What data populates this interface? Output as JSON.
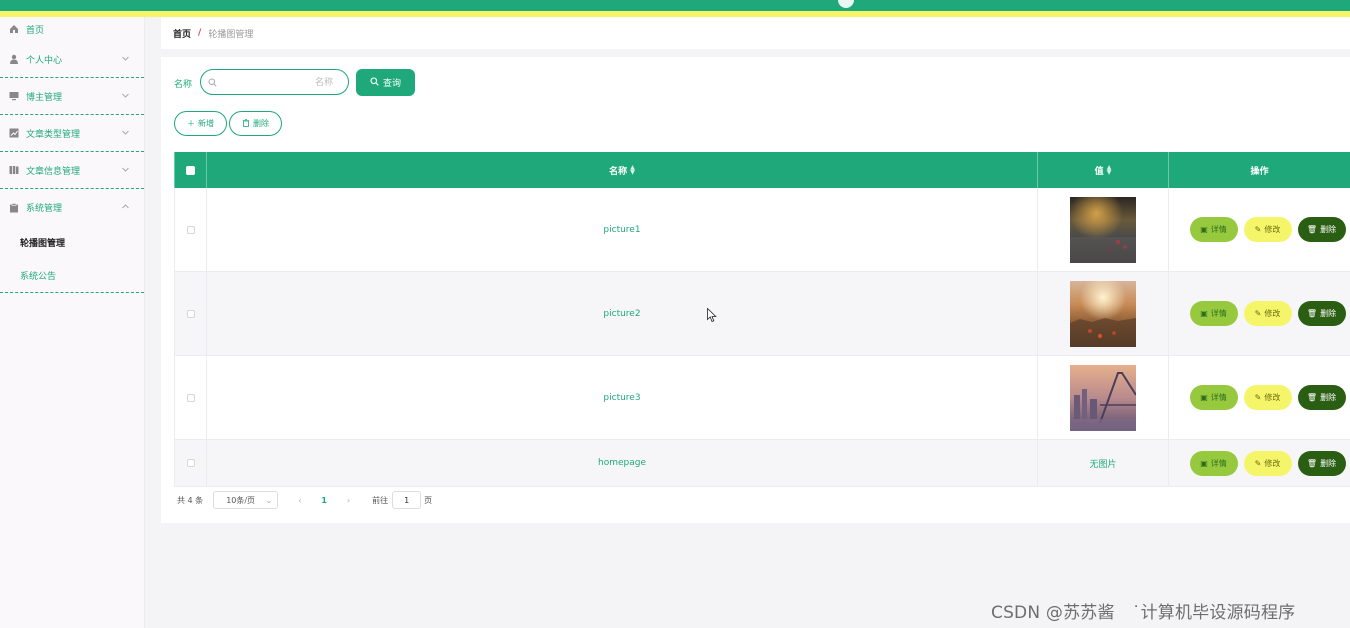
{
  "sidebar": {
    "items": [
      {
        "label": "首页",
        "icon": "home-icon"
      },
      {
        "label": "个人中心",
        "icon": "user-icon"
      },
      {
        "label": "博主管理",
        "icon": "monitor-icon"
      },
      {
        "label": "文章类型管理",
        "icon": "chart-icon"
      },
      {
        "label": "文章信息管理",
        "icon": "book-icon"
      },
      {
        "label": "系统管理",
        "icon": "clipboard-icon"
      }
    ],
    "sub_items": [
      {
        "label": "轮播图管理",
        "active": true
      },
      {
        "label": "系统公告",
        "active": false
      }
    ]
  },
  "breadcrumb": {
    "home": "首页",
    "separator": "/",
    "current": "轮播图管理"
  },
  "search": {
    "label": "名称",
    "placeholder": "名称",
    "button": "查询"
  },
  "actions": {
    "add": "新增",
    "delete": "删除"
  },
  "table": {
    "headers": {
      "name": "名称",
      "value": "值",
      "ops": "操作"
    },
    "rows": [
      {
        "name": "picture1",
        "value_type": "image",
        "value": ""
      },
      {
        "name": "picture2",
        "value_type": "image",
        "value": ""
      },
      {
        "name": "picture3",
        "value_type": "image",
        "value": ""
      },
      {
        "name": "homepage",
        "value_type": "text",
        "value": "无图片"
      }
    ],
    "row_actions": {
      "detail": "详情",
      "edit": "修改",
      "remove": "删除"
    }
  },
  "pagination": {
    "total": "共 4 条",
    "page_size": "10条/页",
    "current_page": "1",
    "goto_label": "前往",
    "goto_value": "1",
    "page_suffix": "页"
  },
  "watermark": "CSDN @苏苏酱　˙计算机毕设源码程序",
  "colors": {
    "primary": "#1fa97b",
    "accent_yellow": "#f7f46c",
    "detail_btn": "#96c93d",
    "edit_btn": "#f5f56a",
    "remove_btn": "#2a5e12"
  }
}
